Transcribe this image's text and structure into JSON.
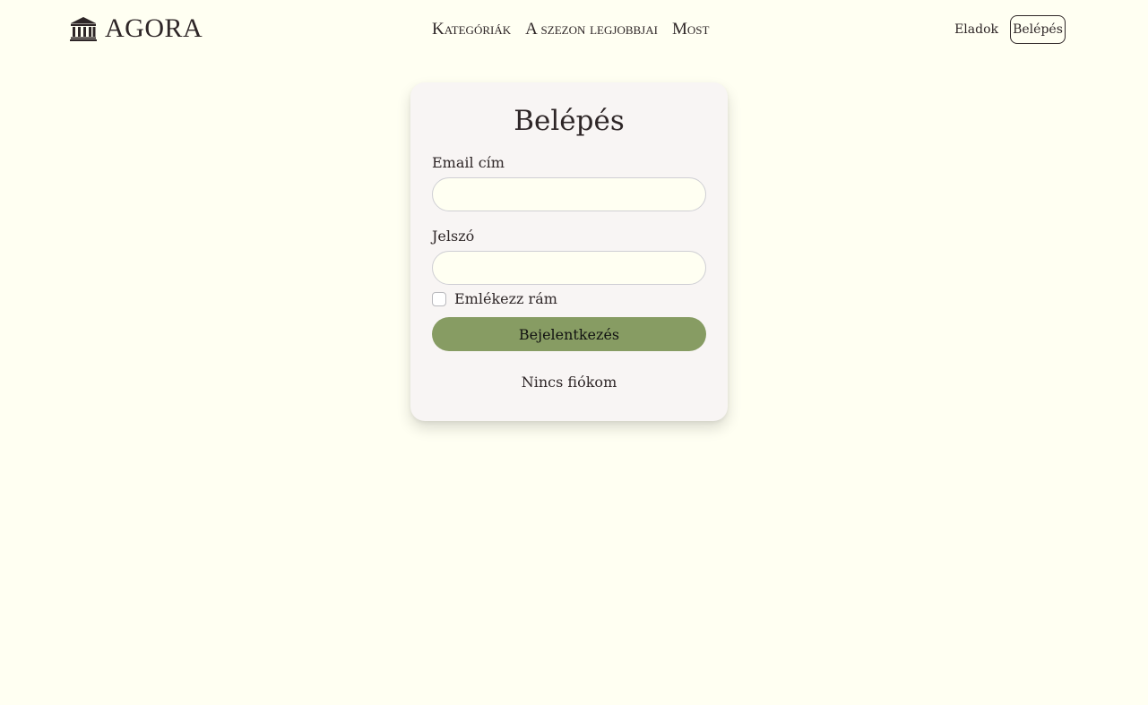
{
  "brand": {
    "name": "AGORA",
    "icon": "museum-icon"
  },
  "nav": {
    "links": [
      {
        "label": "Kategóriák"
      },
      {
        "label": "A szezon legjobbjai"
      },
      {
        "label": "Most"
      }
    ],
    "sell_label": "Eladok",
    "login_label": "Belépés"
  },
  "login_form": {
    "title": "Belépés",
    "email_label": "Email cím",
    "email_value": "",
    "password_label": "Jelszó",
    "password_value": "",
    "remember_label": "Emlékezz rám",
    "remember_checked": false,
    "submit_label": "Bejelentkezés",
    "no_account_label": "Nincs fiókom"
  },
  "colors": {
    "page_background": "#fffff2",
    "card_background": "#f8f5f4",
    "text": "#2e2627",
    "primary_button": "#879c63",
    "input_border": "#cfcfd4"
  }
}
